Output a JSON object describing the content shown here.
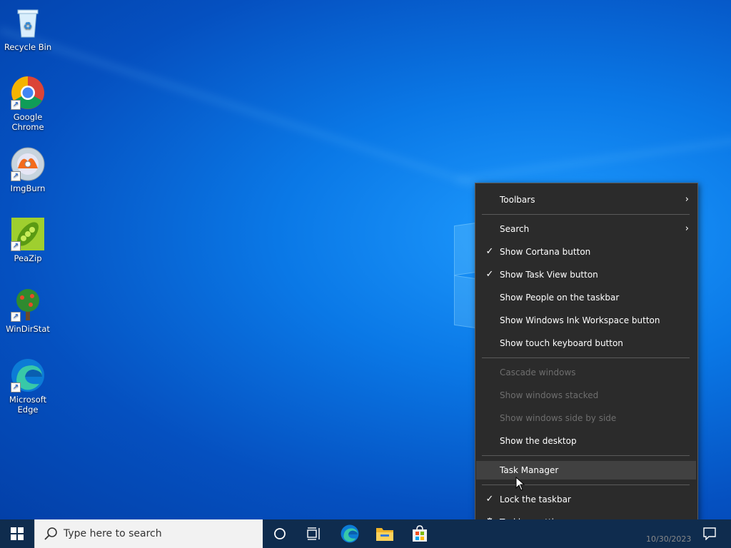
{
  "desktop": {
    "icons": [
      {
        "label": "Recycle Bin",
        "icon": "recycle-bin-icon"
      },
      {
        "label": "Google Chrome",
        "icon": "chrome-icon"
      },
      {
        "label": "ImgBurn",
        "icon": "imgburn-icon"
      },
      {
        "label": "PeaZip",
        "icon": "peazip-icon"
      },
      {
        "label": "WinDirStat",
        "icon": "windirstat-icon"
      },
      {
        "label": "Microsoft Edge",
        "icon": "edge-icon"
      }
    ]
  },
  "context_menu": {
    "items": [
      {
        "label": "Toolbars",
        "submenu": true,
        "checked": false,
        "disabled": false
      },
      {
        "label": "Search",
        "submenu": true,
        "checked": false,
        "disabled": false
      },
      {
        "label": "Show Cortana button",
        "submenu": false,
        "checked": true,
        "disabled": false
      },
      {
        "label": "Show Task View button",
        "submenu": false,
        "checked": true,
        "disabled": false
      },
      {
        "label": "Show People on the taskbar",
        "submenu": false,
        "checked": false,
        "disabled": false
      },
      {
        "label": "Show Windows Ink Workspace button",
        "submenu": false,
        "checked": false,
        "disabled": false
      },
      {
        "label": "Show touch keyboard button",
        "submenu": false,
        "checked": false,
        "disabled": false
      },
      {
        "label": "Cascade windows",
        "submenu": false,
        "checked": false,
        "disabled": true
      },
      {
        "label": "Show windows stacked",
        "submenu": false,
        "checked": false,
        "disabled": true
      },
      {
        "label": "Show windows side by side",
        "submenu": false,
        "checked": false,
        "disabled": true
      },
      {
        "label": "Show the desktop",
        "submenu": false,
        "checked": false,
        "disabled": false
      },
      {
        "label": "Task Manager",
        "submenu": false,
        "checked": false,
        "disabled": false,
        "highlighted": true
      },
      {
        "label": "Lock the taskbar",
        "submenu": false,
        "checked": true,
        "disabled": false
      },
      {
        "label": "Taskbar settings",
        "submenu": false,
        "checked": false,
        "disabled": false,
        "icon": "gear-icon"
      }
    ],
    "glyphs": {
      "check": "✓",
      "arrow": "›",
      "gear": "⚙"
    }
  },
  "taskbar": {
    "search_placeholder": "Type here to search",
    "clock_date": "10/30/2023",
    "buttons": [
      "start-icon",
      "cortana-icon",
      "task-view-icon",
      "edge-icon",
      "file-explorer-icon",
      "store-icon",
      "notification-icon"
    ]
  },
  "colors": {
    "desktop_blue": "#0a78e6",
    "taskbar": "#0f2c4e",
    "menu_bg": "#2b2b2b",
    "menu_hover": "#414141",
    "menu_disabled": "#6e6e6e"
  }
}
